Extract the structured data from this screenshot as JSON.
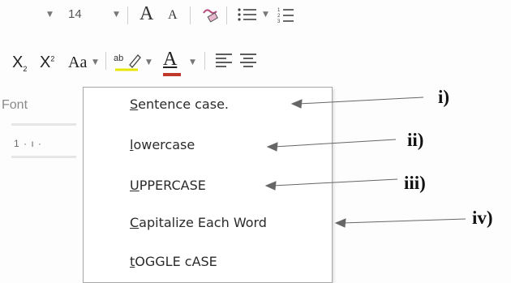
{
  "ribbon": {
    "font_size_value": "14",
    "grow_font_glyph": "A",
    "shrink_font_glyph": "A",
    "subscript_label": "X",
    "subscript_mark": "2",
    "superscript_label": "X",
    "superscript_mark": "2",
    "change_case_label": "Aa",
    "highlight_glyph": "ab",
    "font_color_glyph": "A",
    "font_color_bar": "#c0392b"
  },
  "group_label": "Font",
  "ruler_text": "1 · ı ·",
  "change_case_menu": {
    "items": [
      {
        "accel": "S",
        "rest": "entence case.",
        "marker": "i)"
      },
      {
        "accel": "l",
        "rest": "owercase",
        "marker": "ii)"
      },
      {
        "accel": "U",
        "rest": "PPERCASE",
        "marker": "iii)"
      },
      {
        "accel": "C",
        "rest": "apitalize Each Word",
        "marker": "iv)"
      },
      {
        "accel": "t",
        "rest": "OGGLE cASE"
      }
    ]
  },
  "icons": {
    "clear_formatting": "eraser-icon",
    "bullets": "bullet-list-icon",
    "numbering": "numbered-list-icon",
    "align_left": "align-left-icon",
    "center": "align-center-icon"
  }
}
